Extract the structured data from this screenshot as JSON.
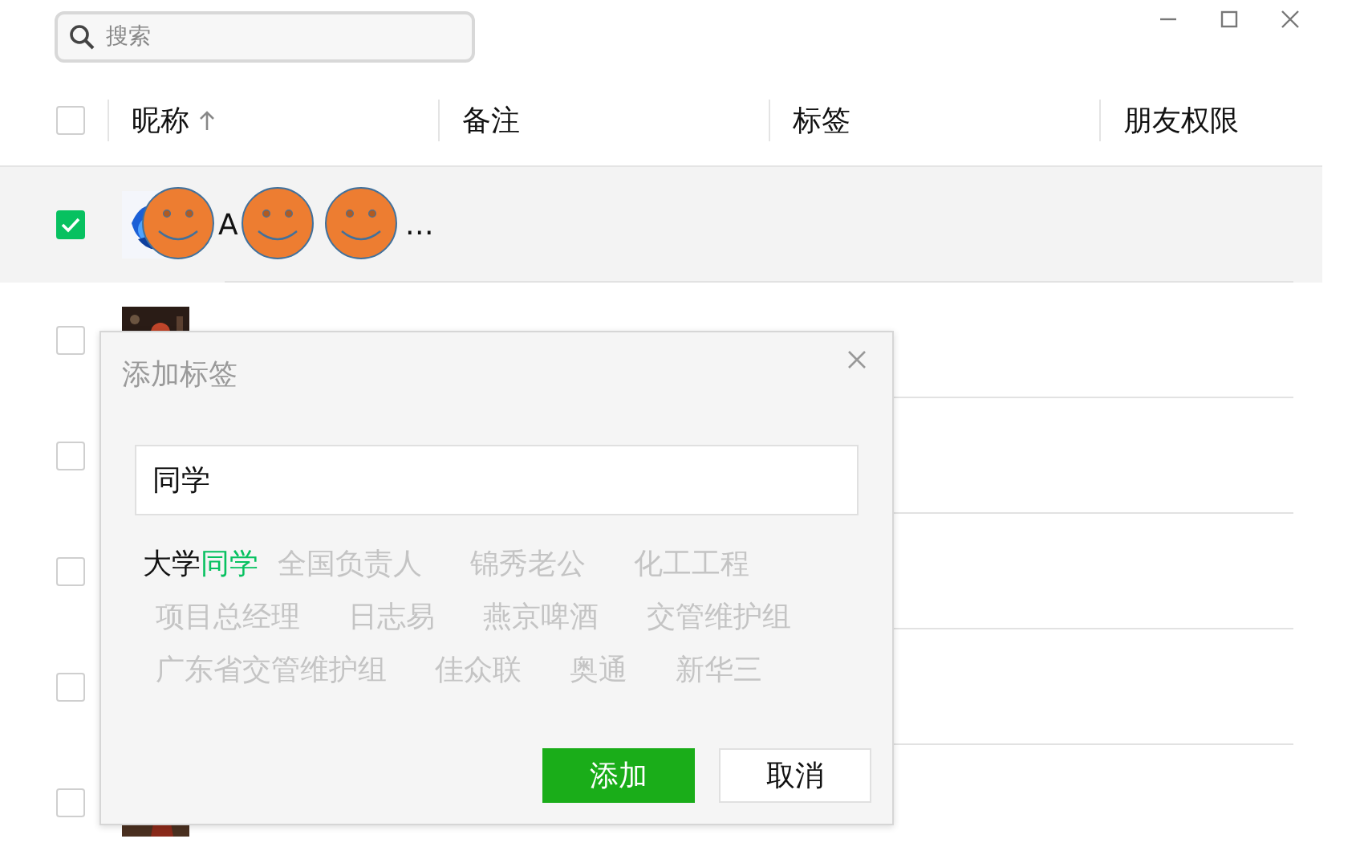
{
  "search": {
    "placeholder": "搜索"
  },
  "columns": [
    {
      "label": "昵称",
      "sorted": true
    },
    {
      "label": "备注"
    },
    {
      "label": "标签"
    },
    {
      "label": "朋友权限"
    }
  ],
  "header_checkbox": {
    "checked": false
  },
  "rows": [
    {
      "selected": true,
      "checked": true,
      "avatar": true,
      "name": "A",
      "name_end": "…",
      "redacted": true
    },
    {
      "selected": false,
      "checked": false,
      "avatar": true,
      "redacted": false
    },
    {
      "selected": false,
      "checked": false
    },
    {
      "selected": false,
      "checked": false
    },
    {
      "selected": false,
      "checked": false
    },
    {
      "selected": false,
      "checked": false,
      "avatar": true,
      "redacted": false
    }
  ],
  "dialog": {
    "title": "添加标签",
    "input": {
      "value": "同学"
    },
    "suggestion": {
      "prefix": "大学",
      "match": "同学"
    },
    "faded_tags": [
      [
        "全国负责人",
        "锦秀老公",
        "化工工程"
      ],
      [
        "项目总经理",
        "日志易",
        "燕京啤酒",
        "交管维护组"
      ],
      [
        "广东省交管维护组",
        "佳众联",
        "奥通",
        "新华三"
      ]
    ],
    "buttons": [
      {
        "label": "添加",
        "kind": "primary"
      },
      {
        "label": "取消",
        "kind": "secondary"
      }
    ]
  }
}
